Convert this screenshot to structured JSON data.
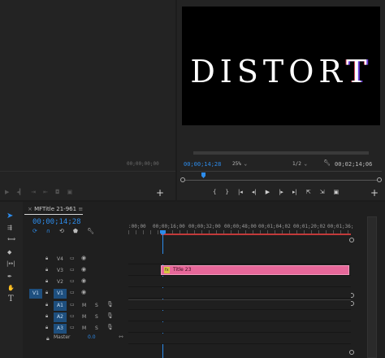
{
  "source_monitor": {
    "timecode": "00;00;00;00"
  },
  "program_monitor": {
    "title_text_main": "DISTOR",
    "title_text_glitch": "T",
    "timecode_current": "00;00;14;28",
    "zoom": "25%",
    "resolution": "1/2",
    "timecode_duration": "00;02;14;06"
  },
  "timeline": {
    "sequence_tab": "MFTitle 21-961",
    "timecode": "00;00;14;28",
    "ruler_ticks": [
      ":00;00",
      "00;00;16;00",
      "00;00;32;00",
      "00;00;48;00",
      "00;01;04;02",
      "00;01;20;02",
      "00;01;36;"
    ],
    "video_tracks": [
      {
        "name": "V4"
      },
      {
        "name": "V3"
      },
      {
        "name": "V2"
      },
      {
        "name": "V1",
        "source": "V1"
      }
    ],
    "audio_tracks": [
      {
        "name": "A1",
        "m": "M",
        "s": "S"
      },
      {
        "name": "A2",
        "m": "M",
        "s": "S"
      },
      {
        "name": "A3",
        "m": "M",
        "s": "S"
      }
    ],
    "master": {
      "name": "Master",
      "value": "0.0"
    },
    "clip": {
      "label": "Title 23",
      "fx": "fx",
      "color": "#e7689a"
    }
  },
  "colors": {
    "accent": "#2d8ceb",
    "clip": "#e7689a",
    "playhead": "#2d8ceb",
    "work_area": "#c23a3a"
  }
}
